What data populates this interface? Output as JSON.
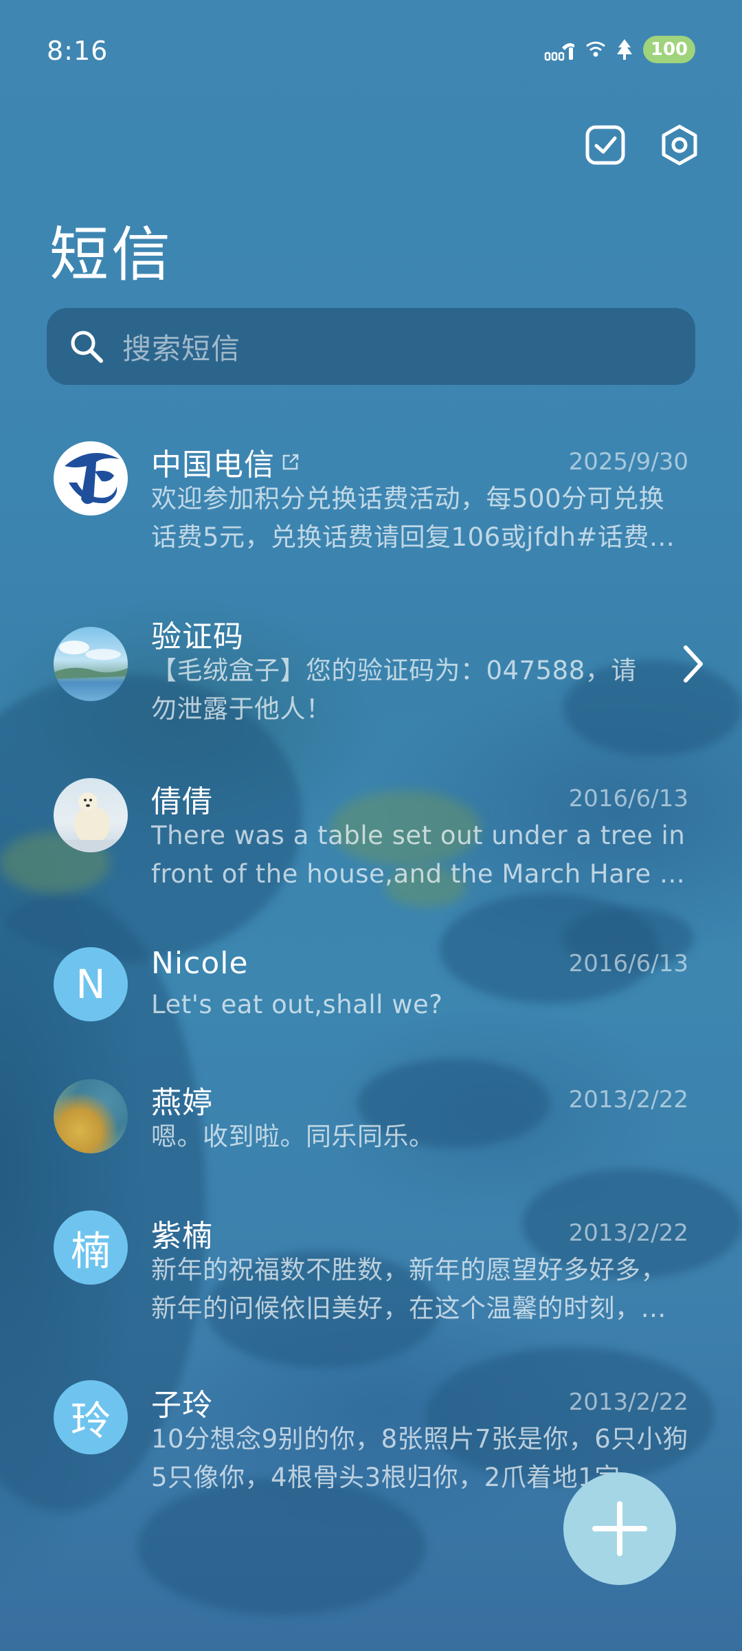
{
  "status_bar": {
    "time": "8:16",
    "battery": "100",
    "icons": [
      "signal-icon",
      "wifi-icon",
      "tree-icon",
      "battery-icon"
    ]
  },
  "top_actions": {
    "icons": [
      "checkbox-edit-icon",
      "settings-hexagon-icon"
    ]
  },
  "title": "短信",
  "search": {
    "placeholder": "搜索短信"
  },
  "conversations": [
    {
      "name": "中国电信",
      "date": "2025/9/30",
      "preview": "欢迎参加积分兑换话费活动，每500分可兑换话费5元，兑换话费请回复106或jfdh#话费…",
      "avatar": "china-telecom-logo",
      "badge": "external-link-icon"
    },
    {
      "name": "验证码",
      "date": "",
      "preview": "【毛绒盒子】您的验证码为：047588，请勿泄露于他人！",
      "avatar": "landscape-photo",
      "action": "chevron-right-icon"
    },
    {
      "name": "倩倩",
      "date": "2016/6/13",
      "preview": "There was a table set out under a tree in front of the house,and the March Hare an…",
      "avatar": "polar-bear-photo"
    },
    {
      "name": "Nicole",
      "date": "2016/6/13",
      "preview": "Let's eat out,shall we?",
      "avatar_letter": "N"
    },
    {
      "name": "燕婷",
      "date": "2013/2/22",
      "preview": "嗯。收到啦。同乐同乐。",
      "avatar": "abstract-photo"
    },
    {
      "name": "紫楠",
      "date": "2013/2/22",
      "preview": "新年的祝福数不胜数，新年的愿望好多好多，新年的问候依旧美好，在这个温馨的时刻，…",
      "avatar_letter": "楠"
    },
    {
      "name": "子玲",
      "date": "2013/2/22",
      "preview": "10分想念9别的你，8张照片7张是你，6只小狗5只像你，4根骨头3根归你，2爪着地1定…",
      "avatar_letter": "玲"
    }
  ],
  "fab": {
    "icon": "plus-icon"
  },
  "colors": {
    "background": "#3b82ad",
    "letter_avatar": "#6ec4ee",
    "fab": "#a5d6e6",
    "battery": "#9fd37c",
    "telecom_blue": "#1f4f9c"
  }
}
